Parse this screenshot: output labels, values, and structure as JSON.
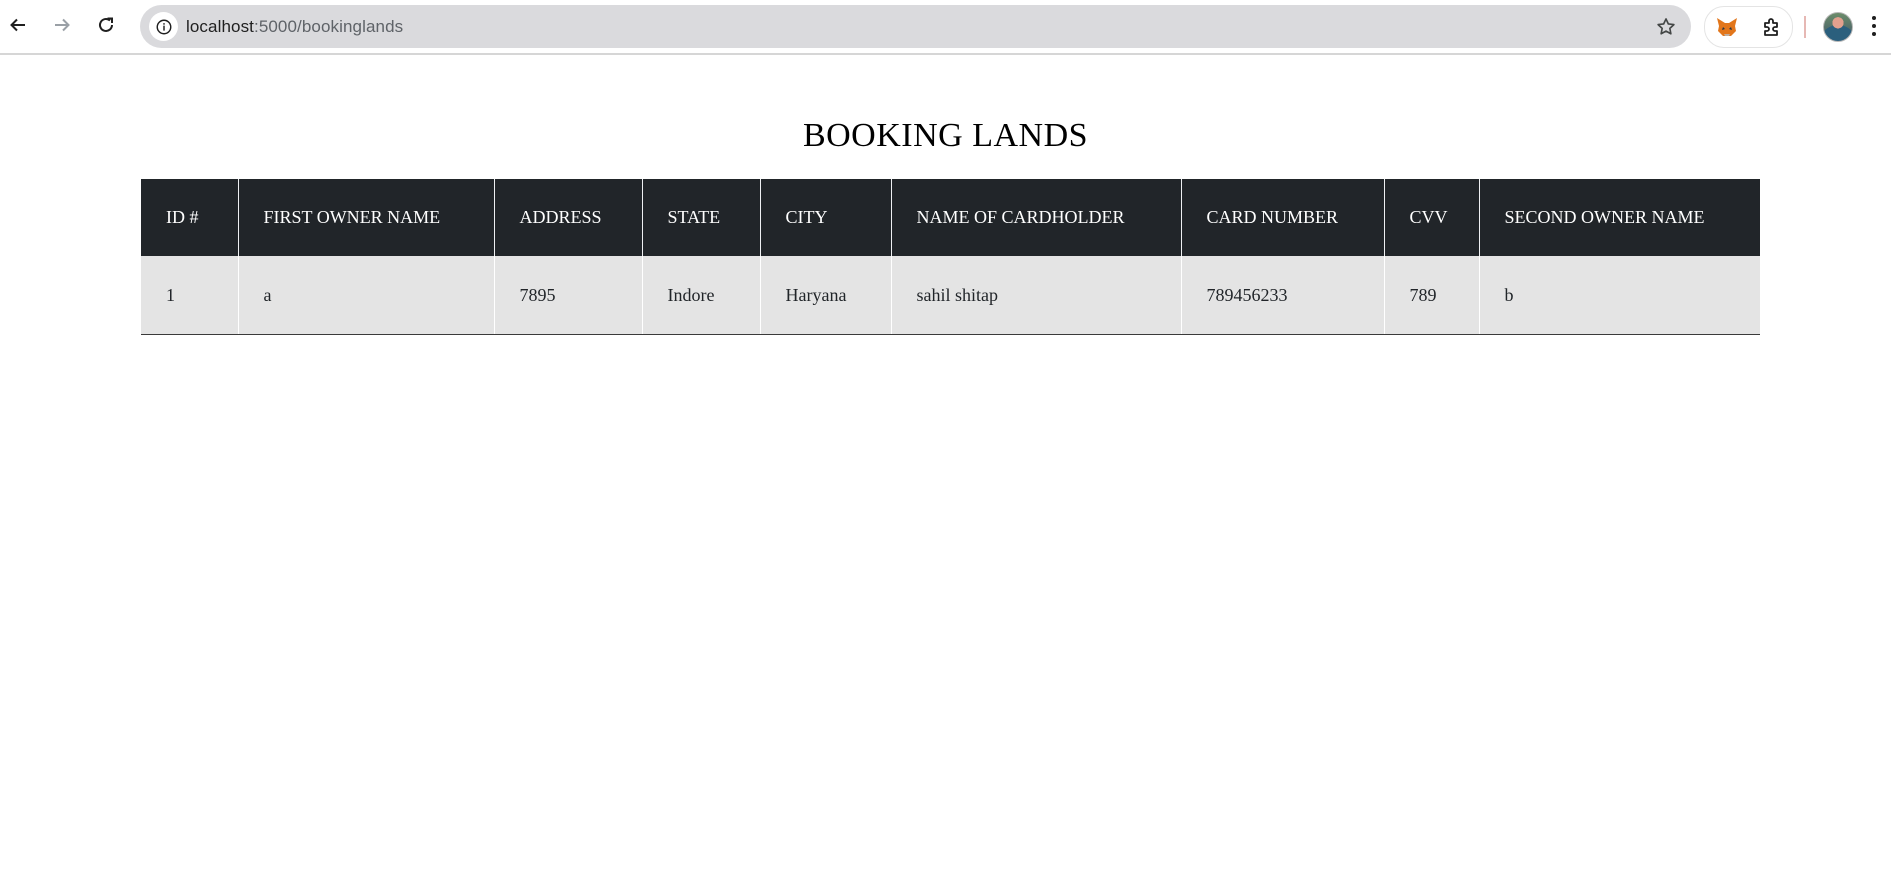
{
  "browser": {
    "url_host": "localhost",
    "url_path": ":5000/bookinglands"
  },
  "page": {
    "title": "BOOKING LANDS"
  },
  "table": {
    "headers": [
      "ID #",
      "FIRST OWNER NAME",
      "ADDRESS",
      "STATE",
      "CITY",
      "NAME OF CARDHOLDER",
      "CARD NUMBER",
      "CVV",
      "SECOND OWNER NAME"
    ],
    "rows": [
      [
        "1",
        "a",
        "7895",
        "Indore",
        "Haryana",
        "sahil shitap",
        "789456233",
        "789",
        "b"
      ]
    ]
  },
  "colors": {
    "header_bg": "#212529",
    "row_bg": "#e4e4e4",
    "omnibox_bg": "#dadadd"
  },
  "icons": {
    "back": "back-arrow-icon",
    "forward": "forward-arrow-icon",
    "reload": "reload-icon",
    "site_info": "info-icon",
    "bookmark": "star-icon",
    "extension_metamask": "fox-icon",
    "extensions": "puzzle-icon",
    "profile": "avatar",
    "menu": "kebab-menu-icon"
  }
}
